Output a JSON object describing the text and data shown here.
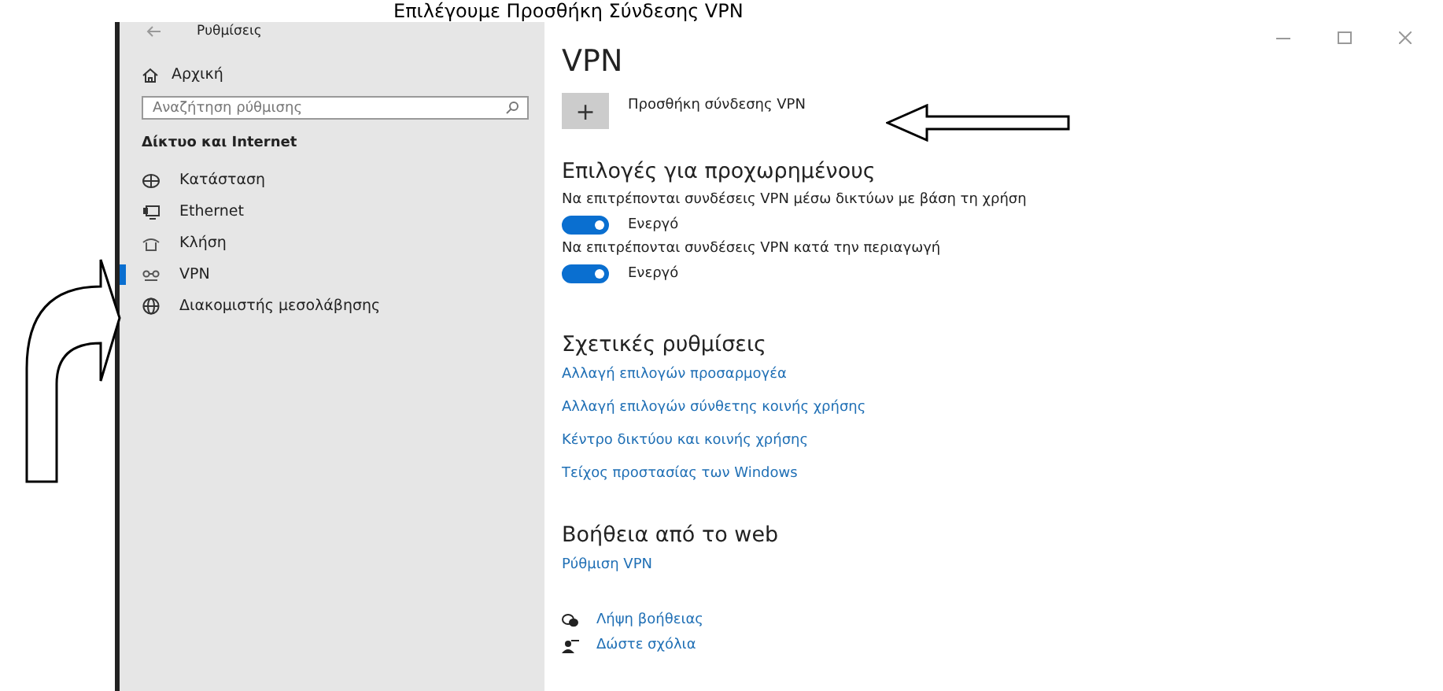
{
  "instruction": "Επιλέγουμε Προσθήκη Σύνδεσης VPN",
  "window": {
    "title": "Ρυθμίσεις"
  },
  "sidebar": {
    "home": "Αρχική",
    "search": {
      "placeholder": "Αναζήτηση ρύθμισης"
    },
    "section": "Δίκτυο και Internet",
    "items": [
      {
        "label": "Κατάσταση",
        "selected": false
      },
      {
        "label": "Ethernet",
        "selected": false
      },
      {
        "label": "Κλήση",
        "selected": false
      },
      {
        "label": "VPN",
        "selected": true
      },
      {
        "label": "Διακομιστής μεσολάβησης",
        "selected": false
      }
    ]
  },
  "content": {
    "title": "VPN",
    "add_button": {
      "icon": "+",
      "label": "Προσθήκη σύνδεσης VPN"
    },
    "advanced": {
      "heading": "Επιλογές για προχωρημένους",
      "options": [
        {
          "label": "Να επιτρέπονται συνδέσεις VPN μέσω δικτύων με βάση τη χρήση",
          "on": true,
          "state_text": "Ενεργό"
        },
        {
          "label": "Να επιτρέπονται συνδέσεις VPN κατά την περιαγωγή",
          "on": true,
          "state_text": "Ενεργό"
        }
      ]
    },
    "related": {
      "heading": "Σχετικές ρυθμίσεις",
      "links": [
        "Αλλαγή επιλογών προσαρμογέα",
        "Αλλαγή επιλογών σύνθετης κοινής χρήσης",
        "Κέντρο δικτύου και κοινής χρήσης",
        "Τείχος προστασίας των Windows"
      ]
    },
    "web_help": {
      "heading": "Βοήθεια από το web",
      "links": [
        "Ρύθμιση VPN"
      ]
    },
    "help": [
      "Λήψη βοήθειας",
      "Δώστε σχόλια"
    ]
  }
}
